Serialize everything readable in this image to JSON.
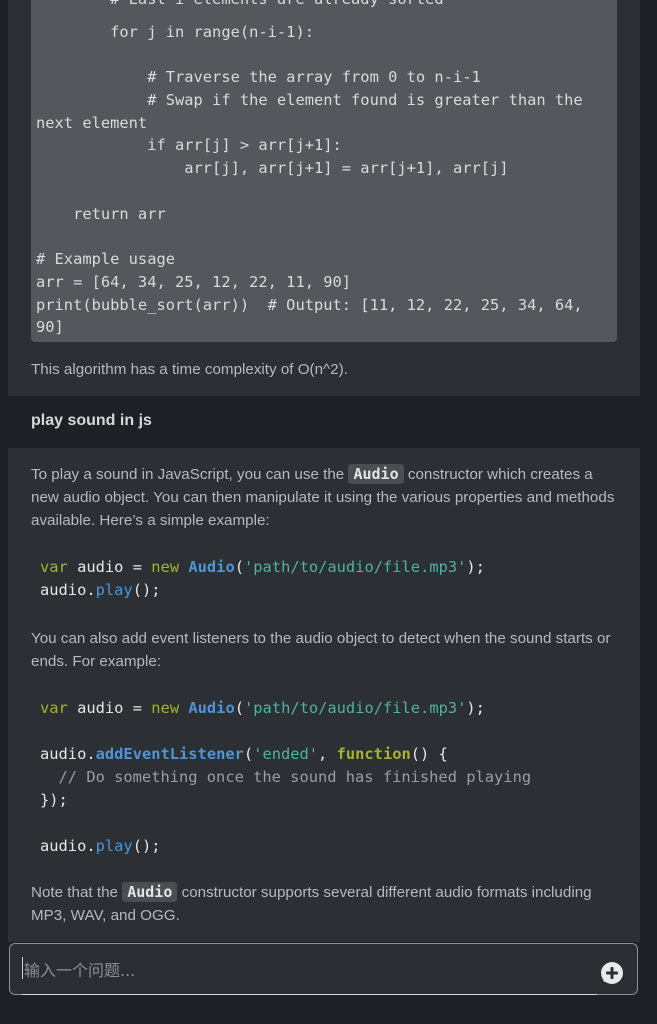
{
  "top_code": {
    "lines": [
      "        # Last i elements are already sorted",
      "        for j in range(n-i-1):",
      "",
      "            # Traverse the array from 0 to n-i-1",
      "            # Swap if the element found is greater than the",
      "next element",
      "            if arr[j] > arr[j+1]:",
      "                arr[j], arr[j+1] = arr[j+1], arr[j]",
      "",
      "    return arr",
      "",
      "# Example usage",
      "arr = [64, 34, 25, 12, 22, 11, 90]",
      "print(bubble_sort(arr))  # Output: [11, 12, 22, 25, 34, 64,",
      "90]"
    ]
  },
  "top_prose": "This algorithm has a time complexity of O(n^2).",
  "question": "play sound in js",
  "answer": {
    "intro_1": "To play a sound in JavaScript, you can use the",
    "intro_code": "Audio",
    "intro_2": "constructor which creates a new audio object. You can then manipulate it using the various properties and methods available. Here’s a simple example:",
    "code1": {
      "kw_var": "var",
      "var_name": "audio",
      "eq": "=",
      "kw_new": "new",
      "cls": "Audio",
      "open": "(",
      "str": "'path/to/audio/file.mp3'",
      "close": ");",
      "obj": "audio",
      "dot": ".",
      "method": "play",
      "call": "();"
    },
    "para2": "You can also add event listeners to the audio object to detect when the sound starts or ends. For example:",
    "code2": {
      "kw_var": "var",
      "var_name": "audio",
      "eq": "=",
      "kw_new": "new",
      "cls": "Audio",
      "open": "(",
      "str": "'path/to/audio/file.mp3'",
      "close": ");",
      "obj": "audio",
      "dot": ".",
      "method_listener": "addEventListener",
      "event_open": "(",
      "event_str": "'ended'",
      "comma": ",",
      "fn_kw": "function",
      "fn_sig": "() {",
      "comment": "  // Do something once the sound has finished playing",
      "end_brace": "});",
      "method_play": "play",
      "call": "();"
    },
    "note_1": "Note that the",
    "note_code": "Audio",
    "note_2": "constructor supports several different audio formats including MP3, WAV, and OGG."
  },
  "input": {
    "placeholder": "输入一个问题..."
  },
  "icons": {
    "send": "add-circle-icon"
  },
  "colors": {
    "background": "#1d2024",
    "panel": "#2c2f33",
    "code_block": "#54575b",
    "keyword": "#a6b32d",
    "class": "#4f95d6",
    "string": "#4fb3a3"
  }
}
